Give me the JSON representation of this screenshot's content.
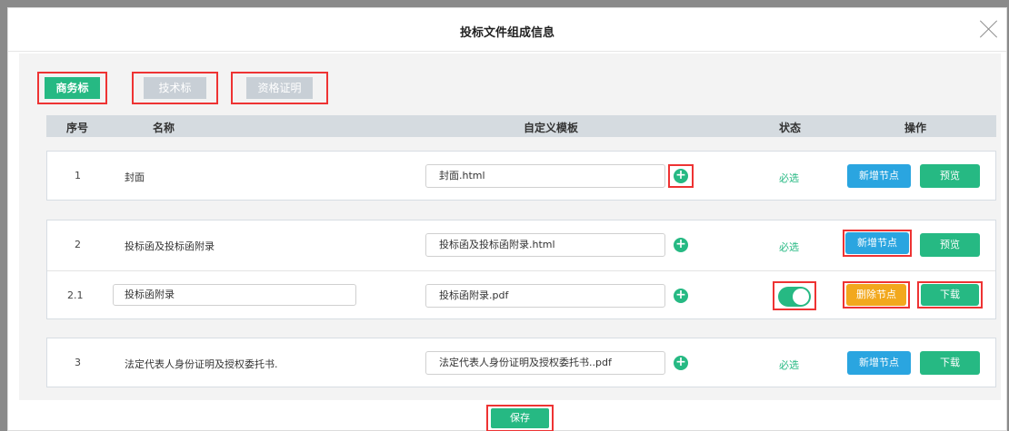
{
  "dialog": {
    "title": "投标文件组成信息"
  },
  "tabs": [
    {
      "label": "商务标"
    },
    {
      "label": "技术标"
    },
    {
      "label": "资格证明"
    }
  ],
  "columns": {
    "no": "序号",
    "name": "名称",
    "template": "自定义模板",
    "status": "状态",
    "actions": "操作"
  },
  "rows": [
    {
      "no": "1",
      "name": "封面",
      "template": "封面.html",
      "status": "必选",
      "btn1": "新增节点",
      "btn2": "预览"
    },
    {
      "no": "2",
      "name": "投标函及投标函附录",
      "template": "投标函及投标函附录.html",
      "status": "必选",
      "btn1": "新增节点",
      "btn2": "预览"
    },
    {
      "no": "2.1",
      "name": "投标函附录",
      "template": "投标函附录.pdf",
      "status": "",
      "btn1": "删除节点",
      "btn2": "下载"
    },
    {
      "no": "3",
      "name": "法定代表人身份证明及授权委托书.",
      "template": "法定代表人身份证明及授权委托书..pdf",
      "status": "必选",
      "btn1": "新增节点",
      "btn2": "下载"
    }
  ],
  "footer": {
    "save_label": "保存"
  },
  "icons": {
    "close": "close-icon",
    "add": "plus-circle-icon",
    "toggle": "toggle-switch-icon"
  },
  "colors": {
    "primary": "#26b983",
    "blue": "#2aa5e0",
    "orange": "#f2a81d",
    "highlight": "#e33333"
  }
}
